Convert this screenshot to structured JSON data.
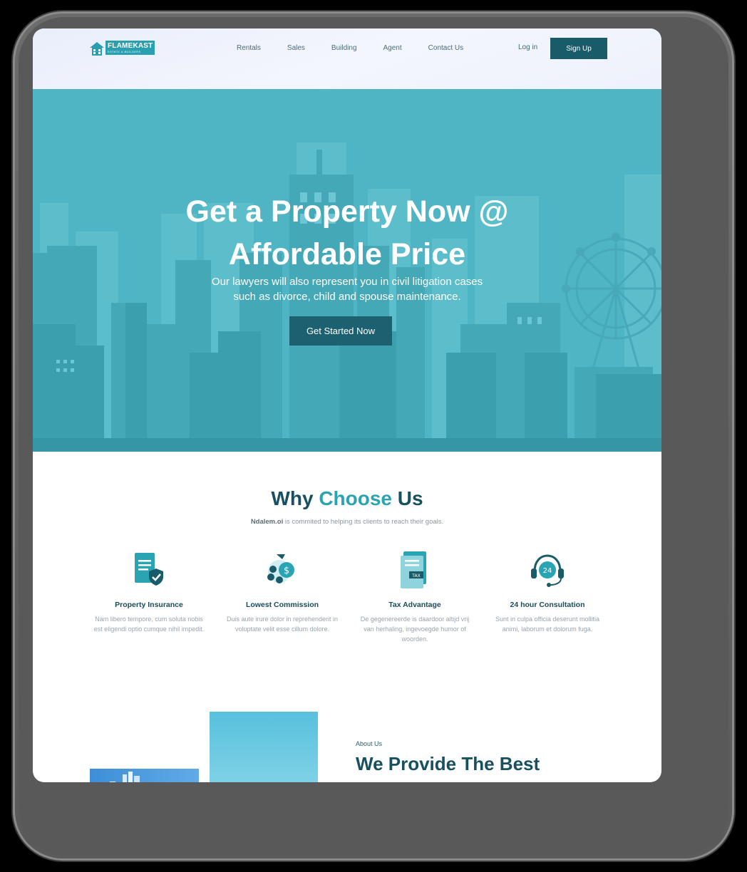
{
  "brand": {
    "name": "FLAMEKAST",
    "tagline": "ESTATE & BUILDERS"
  },
  "nav": {
    "items": [
      "Rentals",
      "Sales",
      "Building",
      "Agent",
      "Contact Us"
    ],
    "login": "Log in",
    "signup": "Sign Up"
  },
  "hero": {
    "title_line1": "Get a Property Now @",
    "title_line2": "Affordable Price",
    "subtitle_line1": "Our lawyers will also represent you in civil litigation cases",
    "subtitle_line2": "such as divorce, child and spouse maintenance.",
    "cta": "Get Started Now"
  },
  "why": {
    "title_part1": "Why",
    "title_accent": "Choose",
    "title_part2": "Us",
    "sub_brand": "Ndalem.oi",
    "sub_text": " is commited to helping its clients to reach their goals.",
    "features": [
      {
        "icon": "document-shield-icon",
        "title": "Property Insurance",
        "text": "Nam libero tempore, cum soluta nobis est eligendi optio cumque nihil impedit."
      },
      {
        "icon": "money-bag-coins-icon",
        "title": "Lowest Commission",
        "text": "Duis aute irure dolor in reprehenderit in voluptate velit esse cillum dolore."
      },
      {
        "icon": "tax-document-icon",
        "title": "Tax Advantage",
        "text": "De gegenereerde is daardoor altijd vrij van herhaling, ingevoegde humor of woorden."
      },
      {
        "icon": "headset-24-icon",
        "title": "24 hour Consultation",
        "text": "Sunt in culpa officia deserunt mollitia animi, laborum et dolorum fuga."
      }
    ]
  },
  "about": {
    "kicker": "About Us",
    "title": "We Provide The Best"
  },
  "colors": {
    "primary": "#1a5b6a",
    "accent": "#2aa3b3",
    "hero_bg": "#4fb4c3"
  }
}
